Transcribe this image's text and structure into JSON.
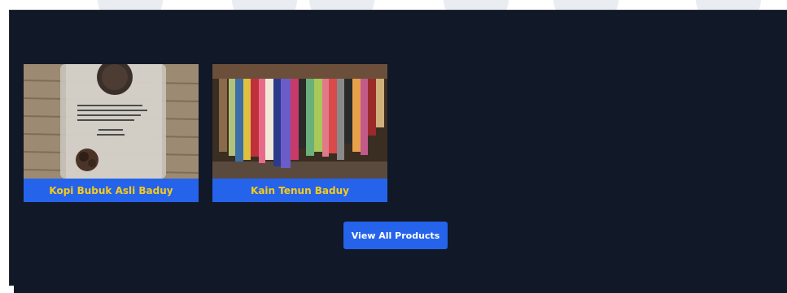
{
  "products": [
    {
      "name": "Kopi Bubuk Asli Baduy",
      "image": "coffee-bag-image"
    },
    {
      "name": "Kain Tenun Baduy",
      "image": "woven-cloth-image"
    }
  ],
  "cta": {
    "label": "View All Products"
  },
  "colors": {
    "background": "#111827",
    "label_bg": "#2563eb",
    "label_text": "#facc15",
    "button_bg": "#2563eb",
    "button_text": "#ffffff"
  }
}
